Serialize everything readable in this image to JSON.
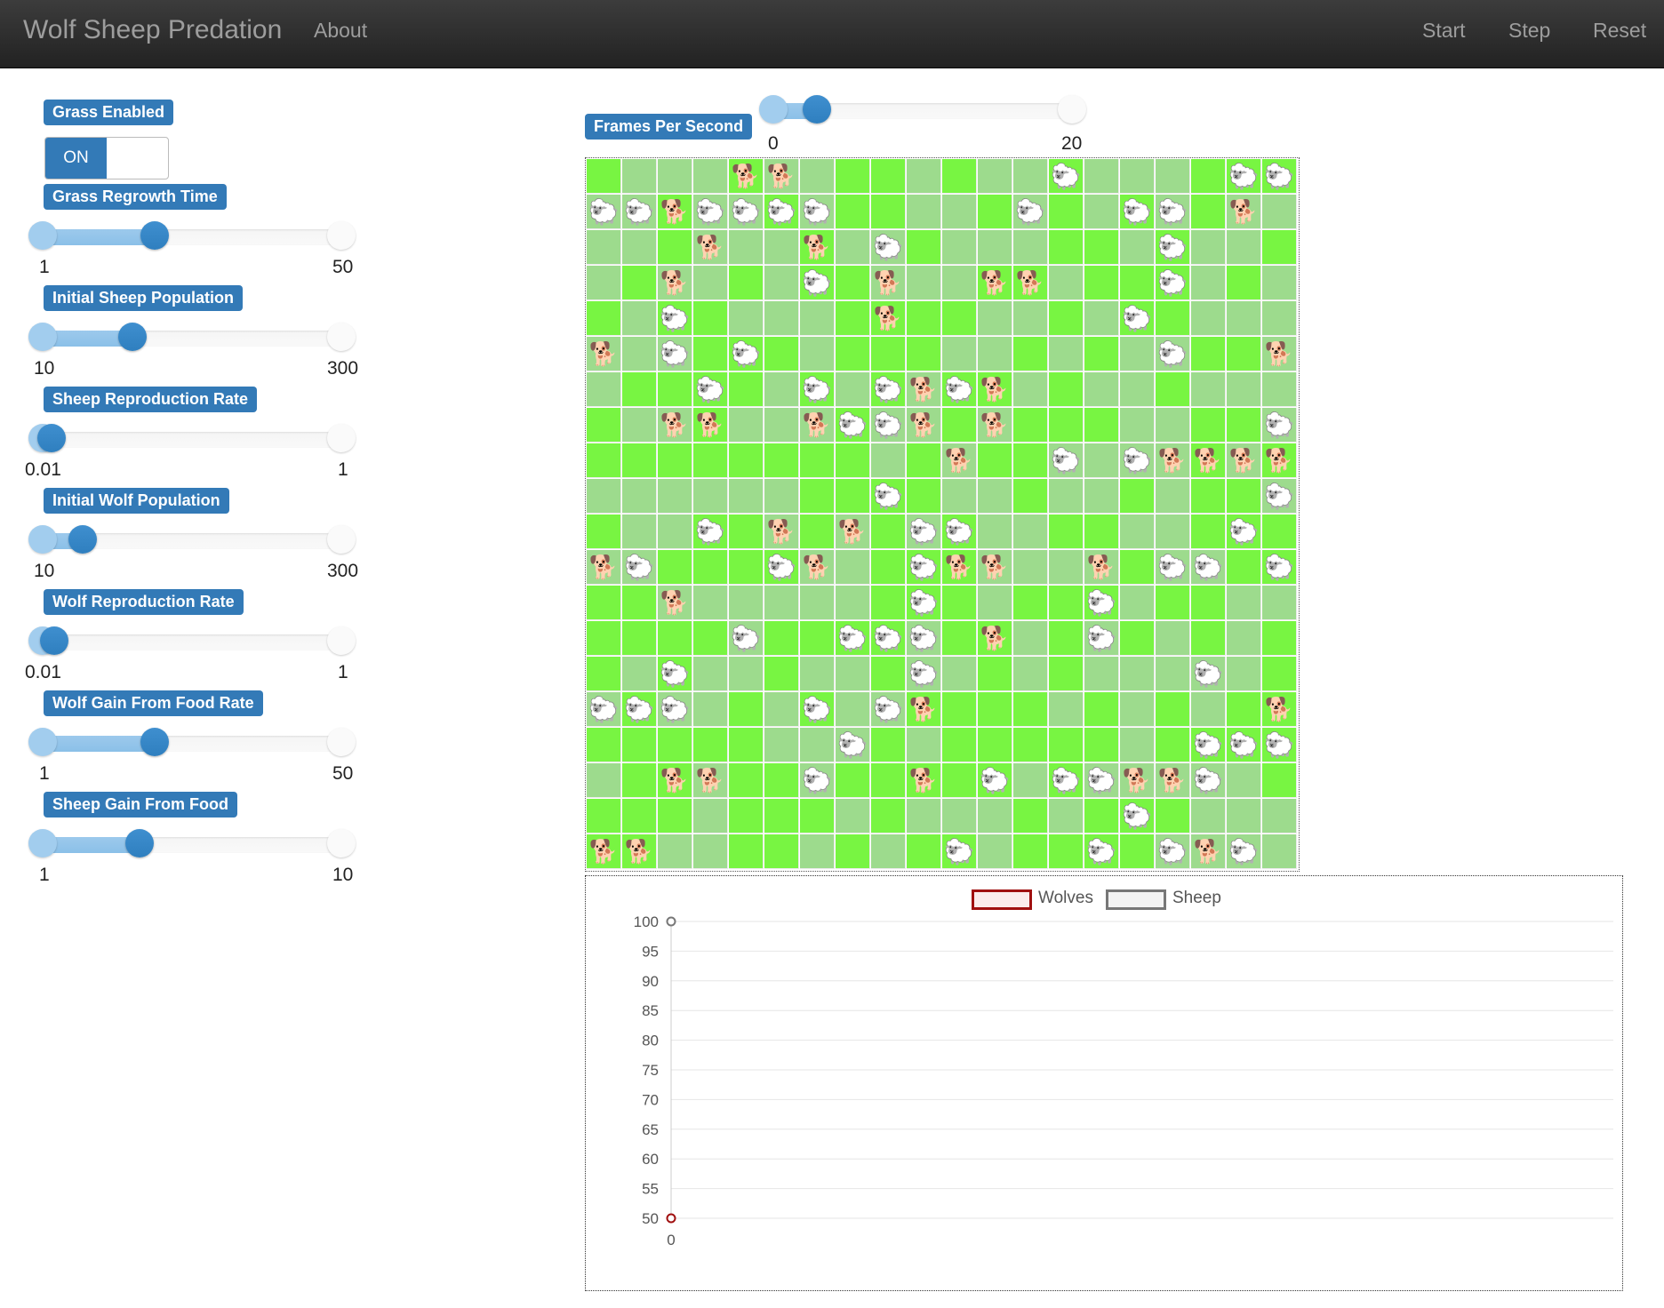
{
  "nav": {
    "brand": "Wolf Sheep Predation",
    "about": "About",
    "start": "Start",
    "step": "Step",
    "reset": "Reset"
  },
  "controls": {
    "grass_enabled_label": "Grass Enabled",
    "grass_toggle": "ON",
    "sliders": [
      {
        "label": "Grass Regrowth Time",
        "min": "1",
        "max": "50",
        "value": 20
      },
      {
        "label": "Initial Sheep Population",
        "min": "10",
        "max": "300",
        "value": 100
      },
      {
        "label": "Sheep Reproduction Rate",
        "min": "0.01",
        "max": "1",
        "value": 0.04
      },
      {
        "label": "Initial Wolf Population",
        "min": "10",
        "max": "300",
        "value": 50
      },
      {
        "label": "Wolf Reproduction Rate",
        "min": "0.01",
        "max": "1",
        "value": 0.05
      },
      {
        "label": "Wolf Gain From Food Rate",
        "min": "1",
        "max": "50",
        "value": 20
      },
      {
        "label": "Sheep Gain From Food",
        "min": "1",
        "max": "10",
        "value": 4
      }
    ],
    "fps": {
      "label": "Frames Per Second",
      "min": "0",
      "max": "20",
      "value": 3
    }
  },
  "icons": {
    "sheep": "sheep-icon",
    "wolf": "wolf-icon"
  },
  "colors": {
    "grass_full": "#78f542",
    "grass_eaten": "#9ddb8d",
    "label_bg": "#337ab7",
    "wolves_line": "#a01010",
    "sheep_line": "#777777"
  },
  "grid": {
    "size": 20,
    "grass": [
      "10001001101001000111",
      "00100101100101010100",
      "00100010010001101001",
      "01001011000110111010",
      "10110001111001011000",
      "00011101110010100110",
      "01111010101101001000",
      "10010001001011100110",
      "11111111010110000101",
      "00000011110010010110",
      "10011010101001100111",
      "00111100111000010011",
      "11000000111011101100",
      "11110111101101010101",
      "10100100100101000001",
      "01001010011110101011",
      "11111000101111101111",
      "01101101111101000001",
      "11101110100010111000",
      "11001101011011110000"
    ],
    "agents": [
      "....WW.......S....SS",
      "SSWSSSS.....S..SS.W.",
      "...W..W.S.......S...",
      "..W...S.W..WW...S...",
      "..S.....W......S.....",
      "W.S.S...........S..W.S",
      "...S..S.SWSW.........",
      "..WW..WSSW.W.......S.",
      "..........W..S.SWWWWW.",
      "........S..........S.SW",
      "...S.W.W.SS.......S.S",
      "WS...SW..SWW..W.SS.SS",
      "..W......S....S.....",
      "....S..SSS.W..S.....",
      "..S......S.......S..",
      "SSS...S.SW.........WS",
      ".......S.........SSS",
      "..WW..S..W.S.SSWWS..",
      "...............S......S.",
      "WW........S...S.SWS.."
    ]
  },
  "chart_data": {
    "type": "line",
    "title": "",
    "xlabel": "",
    "ylabel": "",
    "x": [
      0
    ],
    "series": [
      {
        "name": "Wolves",
        "values": [
          50
        ]
      },
      {
        "name": "Sheep",
        "values": [
          100
        ]
      }
    ],
    "ylim": [
      50,
      100
    ],
    "yticks": [
      "100",
      "95",
      "90",
      "85",
      "80",
      "75",
      "70",
      "65",
      "60",
      "55",
      "50"
    ],
    "xticks": [
      "0"
    ],
    "legend": "top"
  }
}
